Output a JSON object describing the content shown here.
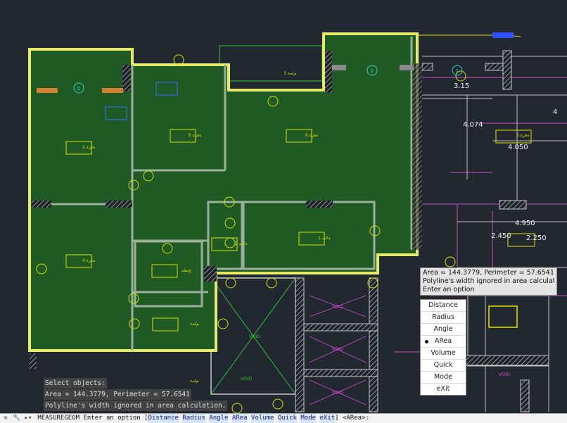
{
  "drawing": {
    "room_tags": [
      "ﺔﻓﺮﻏ 2",
      "ﺔﻓﺮﻏ 5",
      "ﺔﻓﺮﻏ 6",
      "ﺔﻓﺮﻏ 4",
      "ﺔﻟﺎﺻ 2",
      "ﺦﺒﻄﻣ",
      "ﺔﻓﺮﻏ 6",
      "ﻡﺎﻤﺣ",
      "ﻡﺎﻤﺣ",
      "ﺔﻟﺎﺻ 1",
      "ﻡﺎﻤﺣ 3"
    ],
    "void_labels": [
      "VOID",
      "VOID",
      "VOID",
      "VOID",
      "VOID",
      "VOID"
    ],
    "dimensions": [
      "3.15",
      "4.074",
      "4.050",
      "4",
      "4.950",
      "2.450",
      "2.250"
    ],
    "marker_numbers": [
      "2",
      "1",
      "1"
    ]
  },
  "tooltip": {
    "line1": "Area = 144.3779, Perimeter = 57.6541",
    "line2": "Polyline's width ignored in area calculation.",
    "line3": "Enter an option"
  },
  "options_menu": {
    "items": [
      "Distance",
      "Radius",
      "Angle",
      "ARea",
      "Volume",
      "Quick",
      "Mode",
      "eXit"
    ],
    "selected": "ARea"
  },
  "command_history": {
    "line1": "Select objects:",
    "line2": "Area = 144.3779, Perimeter = 57.6541",
    "line3": "Polyline's width ignored in area calculation."
  },
  "command_line": {
    "command": "MEASUREGEOM",
    "prompt": "Enter an option [",
    "options": [
      "Distance",
      "Radius",
      "Angle",
      "ARea",
      "Volume",
      "Quick",
      "Mode",
      "eXit"
    ],
    "suffix": "] <ARea>:"
  },
  "colors": {
    "background": "#212830",
    "area_fill": "#1f5a25",
    "selection_outline": "#e5ea6a",
    "wall": "#c8c8c8",
    "annotation": "#cde000"
  }
}
